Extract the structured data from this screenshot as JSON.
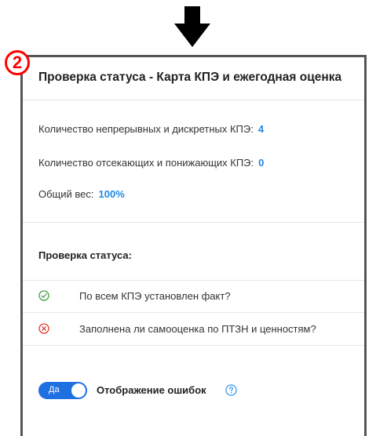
{
  "annotation": {
    "step_number": "2"
  },
  "panel": {
    "title": "Проверка статуса - Карта КПЭ и ежегодная оценка",
    "stats": [
      {
        "label": "Количество непрерывных и дискретных КПЭ:",
        "value": "4"
      },
      {
        "label": "Количество отсекающих и понижающих КПЭ:",
        "value": "0"
      },
      {
        "label": "Общий вес:",
        "value": "100%"
      }
    ],
    "status_check_heading": "Проверка статуса:",
    "checks": [
      {
        "label": "По всем КПЭ установлен факт?",
        "icon": "check-circle-icon",
        "state": "passed"
      },
      {
        "label": "Заполнена ли самооценка по ПТЗН и ценностям?",
        "icon": "error-circle-icon",
        "state": "failed"
      }
    ],
    "toggle": {
      "state_label": "Да",
      "label": "Отображение ошибок",
      "enabled": true
    }
  },
  "colors": {
    "accent": "#1e6fe0",
    "value": "#1e88e5",
    "success": "#43a047",
    "error": "#e53935",
    "badge": "#ff0000"
  }
}
